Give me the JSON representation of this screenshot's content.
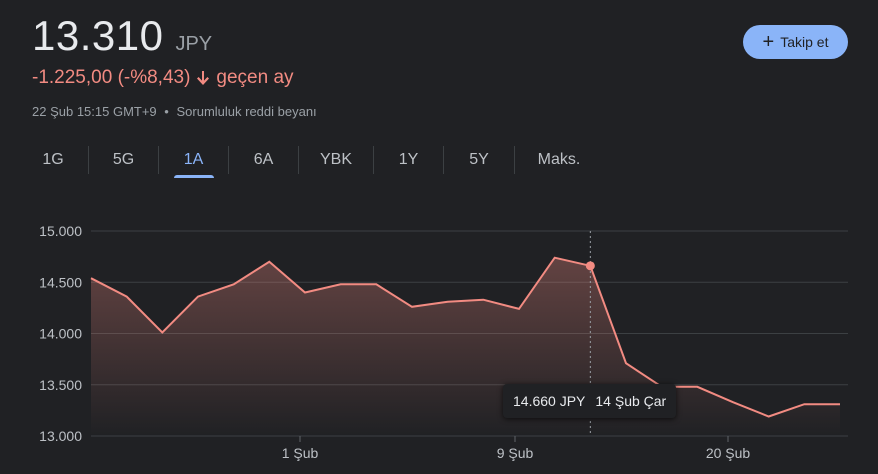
{
  "quote": {
    "price": "13.310",
    "currency": "JPY",
    "change": "-1.225,00 (-%8,43)",
    "period": "geçen ay",
    "timestamp": "22 Şub 15:15 GMT+9",
    "disclaimer": "Sorumluluk reddi beyanı",
    "change_color": "#f28b82"
  },
  "follow_button": {
    "label": "Takip et",
    "icon": "plus-icon"
  },
  "tabs": [
    {
      "label": "1G",
      "active": false
    },
    {
      "label": "5G",
      "active": false
    },
    {
      "label": "1A",
      "active": true
    },
    {
      "label": "6A",
      "active": false
    },
    {
      "label": "YBK",
      "active": false
    },
    {
      "label": "1Y",
      "active": false
    },
    {
      "label": "5Y",
      "active": false
    },
    {
      "label": "Maks.",
      "active": false
    }
  ],
  "tooltip": {
    "price": "14.660 JPY",
    "date": "14 Şub Çar"
  },
  "chart_data": {
    "type": "area",
    "x_tick_labels": [
      "1 Şub",
      "9 Şub",
      "20 Şub"
    ],
    "y_tick_labels": [
      "15.000",
      "14.500",
      "14.000",
      "13.500",
      "13.000"
    ],
    "ylim": [
      13000,
      15000
    ],
    "grid": true,
    "line_color": "#f28b82",
    "series": [
      {
        "values": [
          14540,
          14360,
          14010,
          14360,
          14480,
          14700,
          14400,
          14480,
          14480,
          14260,
          14310,
          14330,
          14240,
          14740,
          14660,
          13710,
          13480,
          13480,
          13330,
          13190,
          13310,
          13310
        ]
      }
    ],
    "highlight_index": 14
  }
}
